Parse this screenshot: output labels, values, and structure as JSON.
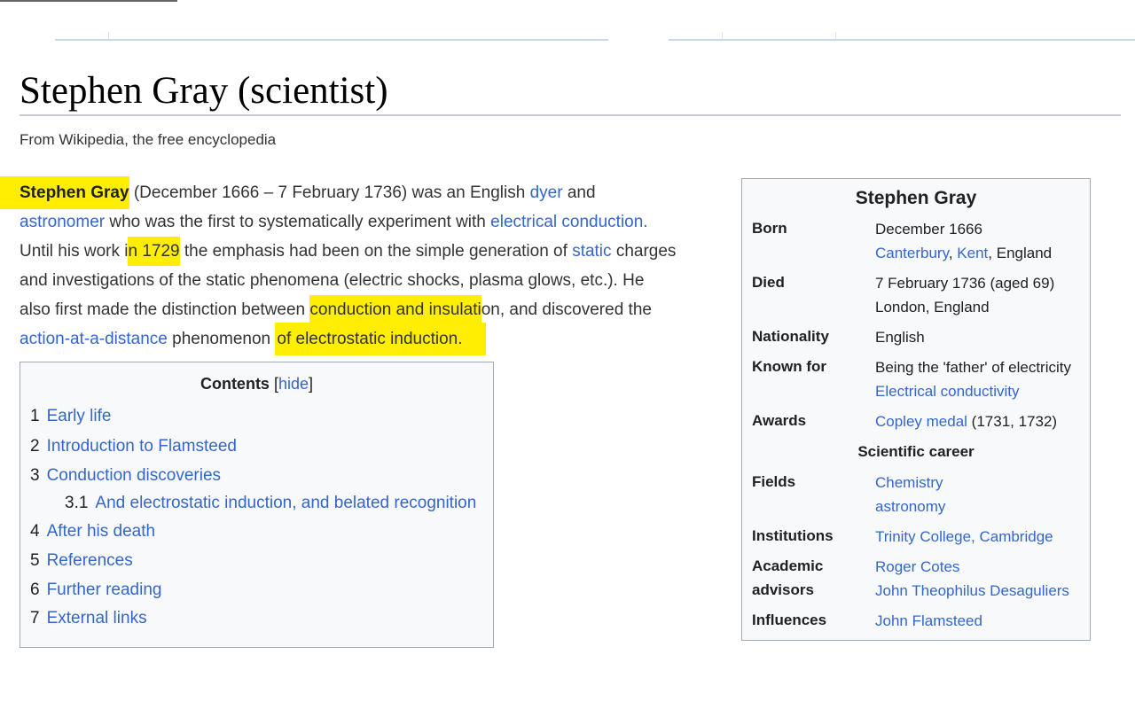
{
  "article": {
    "title": "Stephen Gray (scientist)",
    "tagline": "From Wikipedia, the free encyclopedia"
  },
  "lead": {
    "p1_name": "Stephen Gray",
    "p1_a": " (December 1666 – 7 February 1736) was an English ",
    "p1_link_dyer": "dyer",
    "p1_b": " and",
    "p2_link_astronomer": "astronomer",
    "p2_a": " who was the first to systematically experiment with ",
    "p2_link_electrical_conduction": "electrical conduction.",
    "p3_a": "Until his work i",
    "p3_hl": "n 1729",
    "p3_b": " the emphasis had been on the simple generation of ",
    "p3_link_static": "static",
    "p3_c": " charges",
    "p4": "and investigations of the static phenomena (electric shocks, plasma glows, etc.). He",
    "p5_a": "also first made the distinction between ",
    "p5_hl": "conduction and insulati",
    "p5_b": "on, and discovered the",
    "p6_link_action": "action-at-a-distance",
    "p6_a": " phenomenon ",
    "p6_hl": "of electrostatic induction."
  },
  "toc": {
    "title": "Contents",
    "hide_open": "[",
    "hide_label": "hide",
    "hide_close": "]",
    "items": [
      {
        "num": "1",
        "label": "Early life"
      },
      {
        "num": "2",
        "label": "Introduction to Flamsteed"
      },
      {
        "num": "3",
        "label": "Conduction discoveries"
      },
      {
        "num": "3.1",
        "label": "And electrostatic induction, and belated recognition"
      },
      {
        "num": "4",
        "label": "After his death"
      },
      {
        "num": "5",
        "label": "References"
      },
      {
        "num": "6",
        "label": "Further reading"
      },
      {
        "num": "7",
        "label": "External links"
      }
    ]
  },
  "infobox": {
    "title": "Stephen Gray",
    "born_label": "Born",
    "born_date": "December 1666",
    "born_place_link1": "Canterbury",
    "born_place_sep": ", ",
    "born_place_link2": "Kent",
    "born_place_rest": ", England",
    "died_label": "Died",
    "died_date": "7 February 1736 (aged 69)",
    "died_place": "London, England",
    "nationality_label": "Nationality",
    "nationality_value": "English",
    "known_label": "Known for",
    "known_value1": "Being the 'father' of electricity",
    "known_value2_link": "Electrical conductivity",
    "awards_label": "Awards",
    "awards_link": "Copley medal",
    "awards_rest": " (1731, 1732)",
    "career_header": "Scientific career",
    "fields_label": "Fields",
    "fields_link1": "Chemistry",
    "fields_link2": "astronomy",
    "institutions_label": "Institutions",
    "institutions_link": "Trinity College, Cambridge",
    "advisors_label1": "Academic",
    "advisors_label2": "advisors",
    "advisors_link1": "Roger Cotes",
    "advisors_link2": "John Theophilus Desaguliers",
    "influences_label": "Influences",
    "influences_link": "John Flamsteed"
  },
  "colors": {
    "link": "#3366cc",
    "highlight": "#ffee00",
    "box_bg": "#f8f9fa",
    "box_border": "#a2a9b1"
  }
}
